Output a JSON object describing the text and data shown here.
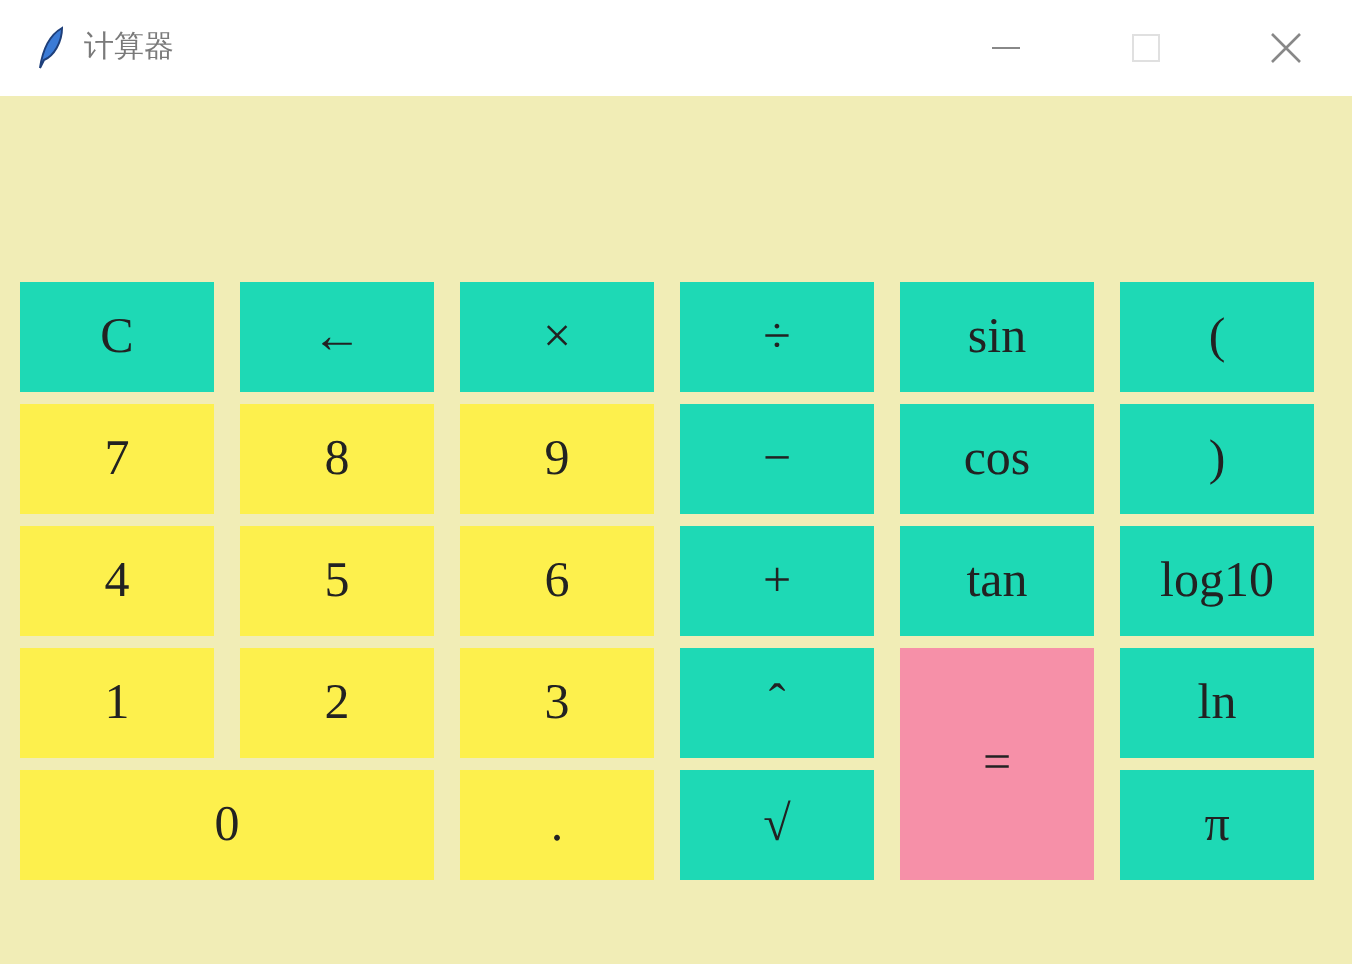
{
  "window": {
    "title": "计算器",
    "maximize_disabled": true
  },
  "buttons": [
    {
      "label": "C",
      "kind": "normal",
      "color": "#1ed9b5"
    },
    {
      "label": "←",
      "kind": "normal",
      "color": "#1ed9b5"
    },
    {
      "label": "×",
      "kind": "normal",
      "color": "#1ed9b5"
    },
    {
      "label": "÷",
      "kind": "normal",
      "color": "#1ed9b5"
    },
    {
      "label": "sin",
      "kind": "normal",
      "color": "#1ed9b5"
    },
    {
      "label": "(",
      "kind": "normal",
      "color": "#1ed9b5"
    },
    {
      "label": "7",
      "kind": "normal",
      "color": "#fdf04d"
    },
    {
      "label": "8",
      "kind": "normal",
      "color": "#fdf04d"
    },
    {
      "label": "9",
      "kind": "normal",
      "color": "#fdf04d"
    },
    {
      "label": "−",
      "kind": "normal",
      "color": "#1ed9b5"
    },
    {
      "label": "cos",
      "kind": "normal",
      "color": "#1ed9b5"
    },
    {
      "label": ")",
      "kind": "normal",
      "color": "#1ed9b5"
    },
    {
      "label": "4",
      "kind": "normal",
      "color": "#fdf04d"
    },
    {
      "label": "5",
      "kind": "normal",
      "color": "#fdf04d"
    },
    {
      "label": "6",
      "kind": "normal",
      "color": "#fdf04d"
    },
    {
      "label": "+",
      "kind": "normal",
      "color": "#1ed9b5"
    },
    {
      "label": "tan",
      "kind": "normal",
      "color": "#1ed9b5"
    },
    {
      "label": "log10",
      "kind": "normal",
      "color": "#1ed9b5"
    },
    {
      "label": "1",
      "kind": "normal",
      "color": "#fdf04d"
    },
    {
      "label": "2",
      "kind": "normal",
      "color": "#fdf04d"
    },
    {
      "label": "3",
      "kind": "normal",
      "color": "#fdf04d"
    },
    {
      "label": "ˆ",
      "kind": "normal",
      "color": "#1ed9b5"
    },
    {
      "label": "=",
      "kind": "tall",
      "color": "#f690a8"
    },
    {
      "label": "ln",
      "kind": "normal",
      "color": "#1ed9b5"
    },
    {
      "label": "0",
      "kind": "wide",
      "color": "#fdf04d"
    },
    {
      "label": ".",
      "kind": "normal",
      "color": "#fdf04d"
    },
    {
      "label": "√",
      "kind": "normal",
      "color": "#1ed9b5"
    },
    {
      "label": "π",
      "kind": "normal",
      "color": "#1ed9b5"
    }
  ]
}
